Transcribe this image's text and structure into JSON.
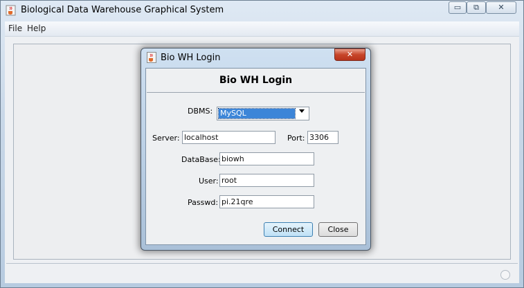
{
  "window": {
    "title": "Biological Data Warehouse Graphical System",
    "controls": {
      "minimize": "▭",
      "maximize": "⧉",
      "close": "✕"
    }
  },
  "menubar": {
    "items": [
      {
        "label": "File"
      },
      {
        "label": "Help"
      }
    ]
  },
  "dialog": {
    "title": "Bio WH Login",
    "heading": "Bio WH Login",
    "close_glyph": "✕",
    "fields": {
      "dbms": {
        "label": "DBMS:",
        "value": "MySQL"
      },
      "server": {
        "label": "Server:",
        "value": "localhost"
      },
      "port": {
        "label": "Port:",
        "value": "3306"
      },
      "database": {
        "label": "DataBase:",
        "value": "biowh"
      },
      "user": {
        "label": "User:",
        "value": "root"
      },
      "passwd": {
        "label": "Passwd:",
        "value": "pi.21qre"
      }
    },
    "buttons": {
      "connect": "Connect",
      "close": "Close"
    }
  },
  "icons": {
    "app": "java-cup-icon",
    "dropdown": "chevron-down-icon"
  },
  "colors": {
    "selection": "#3c85d8",
    "close_button": "#c7452a",
    "default_button_border": "#3c7fb1"
  }
}
